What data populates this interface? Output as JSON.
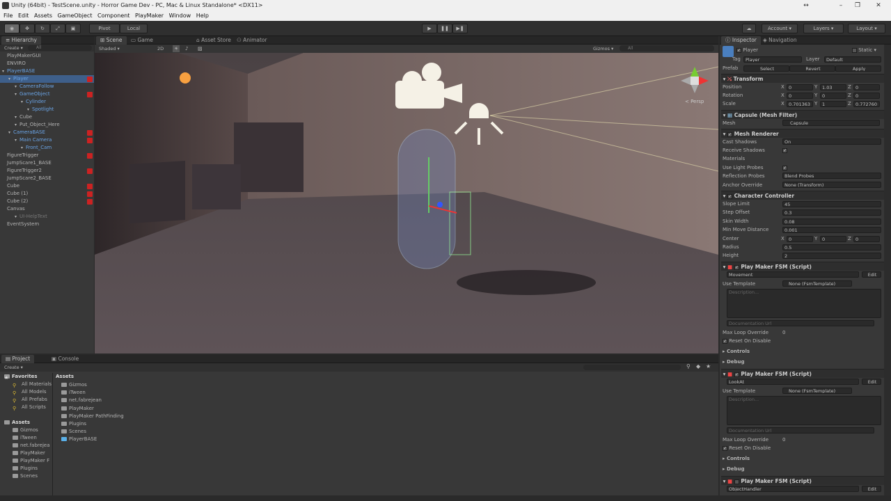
{
  "window": {
    "title": "Unity (64bit) - TestScene.unity - Horror Game Dev - PC, Mac & Linux Standalone* <DX11>"
  },
  "menu": [
    "File",
    "Edit",
    "Assets",
    "GameObject",
    "Component",
    "PlayMaker",
    "Window",
    "Help"
  ],
  "toolbar": {
    "pivot": "Pivot",
    "local": "Local",
    "account": "Account",
    "layers": "Layers",
    "layout": "Layout"
  },
  "tabs": {
    "hierarchy": "Hierarchy",
    "scene": "Scene",
    "game": "Game",
    "asset_store": "Asset Store",
    "animator": "Animator",
    "inspector": "Inspector",
    "navigation": "Navigation",
    "project": "Project",
    "console": "Console"
  },
  "hierarchy": {
    "create": "Create",
    "search_placeholder": "All",
    "items": [
      {
        "label": "PlayMakerGUI",
        "indent": 0,
        "blue": false,
        "pm": false
      },
      {
        "label": "ENVIRO",
        "indent": 0,
        "blue": false,
        "pm": false
      },
      {
        "label": "PlayerBASE",
        "indent": 0,
        "blue": true,
        "pm": false
      },
      {
        "label": "Player",
        "indent": 1,
        "blue": true,
        "pm": true,
        "selected": true
      },
      {
        "label": "CameraFollow",
        "indent": 2,
        "blue": true,
        "pm": false
      },
      {
        "label": "GameObject",
        "indent": 2,
        "blue": true,
        "pm": true
      },
      {
        "label": "Cylinder",
        "indent": 3,
        "blue": true,
        "pm": false
      },
      {
        "label": "Spotlight",
        "indent": 4,
        "blue": true,
        "pm": false
      },
      {
        "label": "Cube",
        "indent": 2,
        "blue": false,
        "pm": false
      },
      {
        "label": "Put_Object_Here",
        "indent": 2,
        "blue": false,
        "pm": false
      },
      {
        "label": "CameraBASE",
        "indent": 1,
        "blue": true,
        "pm": true
      },
      {
        "label": "Main Camera",
        "indent": 2,
        "blue": true,
        "pm": true
      },
      {
        "label": "Front_Cam",
        "indent": 3,
        "blue": true,
        "pm": false
      },
      {
        "label": "FigureTrigger",
        "indent": 0,
        "blue": false,
        "pm": true
      },
      {
        "label": "JumpScare1_BASE",
        "indent": 0,
        "blue": false,
        "pm": false
      },
      {
        "label": "FigureTrigger2",
        "indent": 0,
        "blue": false,
        "pm": true
      },
      {
        "label": "JumpScare2_BASE",
        "indent": 0,
        "blue": false,
        "pm": false
      },
      {
        "label": "Cube",
        "indent": 0,
        "blue": false,
        "pm": true
      },
      {
        "label": "Cube (1)",
        "indent": 0,
        "blue": false,
        "pm": true
      },
      {
        "label": "Cube (2)",
        "indent": 0,
        "blue": false,
        "pm": true
      },
      {
        "label": "Canvas",
        "indent": 0,
        "blue": false,
        "pm": false
      },
      {
        "label": "UI-HelpText",
        "indent": 2,
        "blue": false,
        "pm": false,
        "dim": true
      },
      {
        "label": "EventSystem",
        "indent": 0,
        "blue": false,
        "pm": false
      }
    ]
  },
  "scene": {
    "shaded": "Shaded",
    "mode2d": "2D",
    "gizmos": "Gizmos",
    "search_placeholder": "All",
    "persp": "< Persp"
  },
  "inspector": {
    "object_name": "Player",
    "static": "Static",
    "tag_label": "Tag",
    "tag_value": "Player",
    "layer_label": "Layer",
    "layer_value": "Default",
    "prefab_label": "Prefab",
    "select": "Select",
    "revert": "Revert",
    "apply": "Apply",
    "transform": {
      "title": "Transform",
      "position_label": "Position",
      "rotation_label": "Rotation",
      "scale_label": "Scale",
      "position": [
        "0",
        "1.03",
        "0"
      ],
      "rotation": [
        "0",
        "0",
        "0"
      ],
      "scale": [
        "0.701363",
        "1",
        "0.772760"
      ]
    },
    "mesh_filter": {
      "title": "Capsule (Mesh Filter)",
      "mesh_label": "Mesh",
      "mesh_value": "Capsule"
    },
    "mesh_renderer": {
      "title": "Mesh Renderer",
      "cast_shadows_label": "Cast Shadows",
      "cast_shadows_value": "On",
      "receive_shadows_label": "Receive Shadows",
      "materials_label": "Materials",
      "use_light_probes_label": "Use Light Probes",
      "reflection_probes_label": "Reflection Probes",
      "reflection_probes_value": "Blend Probes",
      "anchor_override_label": "Anchor Override",
      "anchor_override_value": "None (Transform)"
    },
    "character_controller": {
      "title": "Character Controller",
      "slope_limit_label": "Slope Limit",
      "slope_limit": "45",
      "step_offset_label": "Step Offset",
      "step_offset": "0.3",
      "skin_width_label": "Skin Width",
      "skin_width": "0.08",
      "min_move_label": "Min Move Distance",
      "min_move": "0.001",
      "center_label": "Center",
      "center": [
        "0",
        "0",
        "0"
      ],
      "radius_label": "Radius",
      "radius": "0.5",
      "height_label": "Height",
      "height": "2"
    },
    "fsm1": {
      "title": "Play Maker FSM (Script)",
      "name": "Movement",
      "edit": "Edit",
      "use_template_label": "Use Template",
      "use_template_value": "None (FsmTemplate)",
      "description": "Description...",
      "doc_url": "Documentation Url",
      "max_loop_label": "Max Loop Override",
      "max_loop": "0",
      "reset_label": "Reset On Disable",
      "controls": "Controls",
      "debug": "Debug"
    },
    "fsm2": {
      "title": "Play Maker FSM (Script)",
      "name": "LookAt",
      "edit": "Edit",
      "use_template_label": "Use Template",
      "use_template_value": "None (FsmTemplate)",
      "description": "Description...",
      "doc_url": "Documentation Url",
      "max_loop_label": "Max Loop Override",
      "max_loop": "0",
      "reset_label": "Reset On Disable",
      "controls": "Controls",
      "debug": "Debug"
    },
    "fsm3": {
      "title": "Play Maker FSM (Script)",
      "name": "ObjectHandler",
      "edit": "Edit"
    }
  },
  "project": {
    "create": "Create",
    "favorites_label": "Favorites",
    "favorites": [
      "All Materials",
      "All Models",
      "All Prefabs",
      "All Scripts"
    ],
    "assets_label": "Assets",
    "tree": [
      "Gizmos",
      "iTween",
      "net.fabrejea",
      "PlayMaker",
      "PlayMaker F",
      "Plugins",
      "Scenes"
    ],
    "breadcrumb": "Assets",
    "files": [
      "Gizmos",
      "iTween",
      "net.fabrejean",
      "PlayMaker",
      "PlayMaker PathFinding",
      "Plugins",
      "Scenes",
      "PlayerBASE"
    ]
  }
}
